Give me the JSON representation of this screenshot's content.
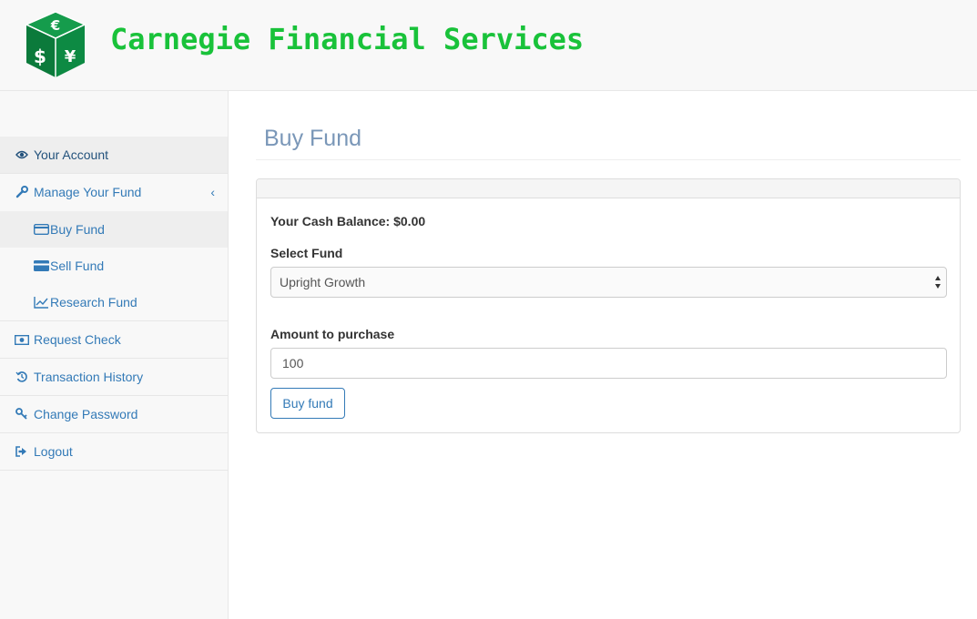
{
  "header": {
    "brand": "Carnegie Financial Services",
    "brand_color": "#19c23a",
    "logo_icon": "currency-dice-logo"
  },
  "sidebar": {
    "items": [
      {
        "label": "Your Account",
        "icon": "eye-icon"
      },
      {
        "label": "Manage Your Fund",
        "icon": "wrench-icon",
        "chevron": "‹"
      },
      {
        "label": "Request Check",
        "icon": "money-icon"
      },
      {
        "label": "Transaction History",
        "icon": "history-icon"
      },
      {
        "label": "Change Password",
        "icon": "key-icon"
      },
      {
        "label": "Logout",
        "icon": "logout-icon"
      }
    ],
    "subitems": [
      {
        "label": "Buy Fund",
        "icon": "credit-card-icon"
      },
      {
        "label": "Sell Fund",
        "icon": "credit-card-solid-icon"
      },
      {
        "label": "Research Fund",
        "icon": "line-chart-icon"
      }
    ]
  },
  "main": {
    "title": "Buy Fund",
    "balance_label": "Your Cash Balance: $0.00",
    "select_label": "Select Fund",
    "select_value": "Upright Growth",
    "amount_label": "Amount to purchase",
    "amount_value": "100",
    "submit_label": "Buy fund"
  },
  "colors": {
    "link": "#337ab7",
    "title": "#7a97b8",
    "logo_green": "#0b7a3b"
  }
}
